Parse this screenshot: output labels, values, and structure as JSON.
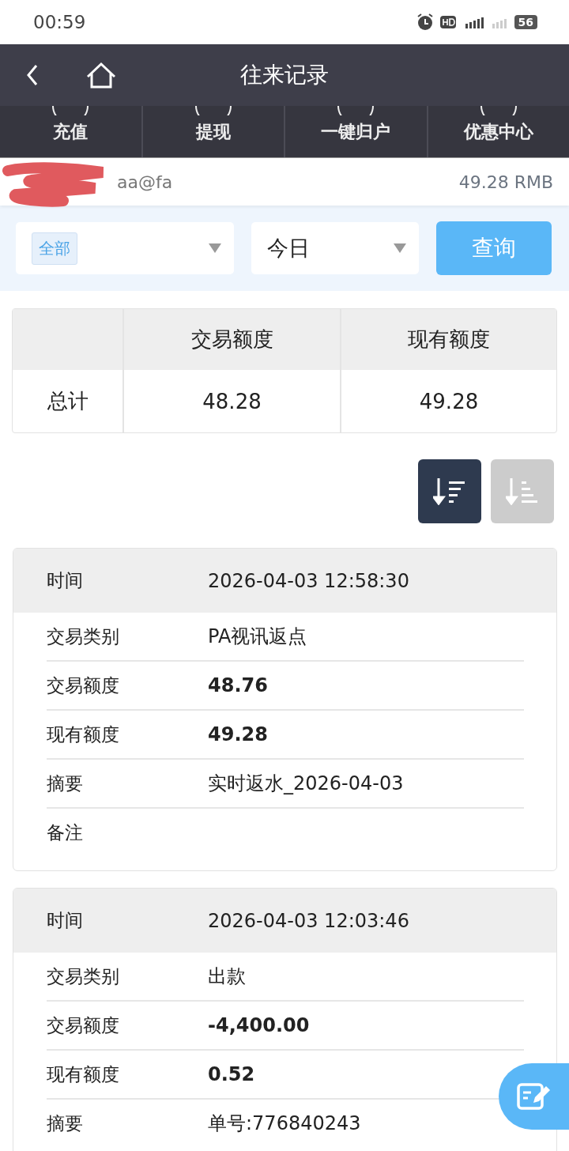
{
  "status_bar": {
    "time": "00:59",
    "battery": "56"
  },
  "header": {
    "title": "往来记录"
  },
  "menu": [
    {
      "label": "充值"
    },
    {
      "label": "提现"
    },
    {
      "label": "一键归户"
    },
    {
      "label": "优惠中心"
    }
  ],
  "account": {
    "user": "aa@fa",
    "balance": "49.28 RMB"
  },
  "filters": {
    "category": {
      "tag": "全部"
    },
    "period": {
      "value": "今日"
    },
    "query_button": "查询"
  },
  "summary": {
    "columns": [
      "交易额度",
      "现有额度"
    ],
    "rows": [
      {
        "label": "总计",
        "cells": [
          "48.28",
          "49.28"
        ]
      }
    ]
  },
  "sort_buttons": [
    {
      "kind": "desc",
      "selected": true
    },
    {
      "kind": "asc",
      "selected": false
    }
  ],
  "records": [
    {
      "header": {
        "label": "时间",
        "value": "2026-04-03 12:58:30"
      },
      "fields": [
        {
          "label": "交易类别",
          "value": "PA视讯返点",
          "bold": false
        },
        {
          "label": "交易额度",
          "value": "48.76",
          "bold": true
        },
        {
          "label": "现有额度",
          "value": "49.28",
          "bold": true
        },
        {
          "label": "摘要",
          "value": "实时返水_2026-04-03",
          "bold": false
        },
        {
          "label": "备注"
        }
      ]
    },
    {
      "header": {
        "label": "时间",
        "value": "2026-04-03 12:03:46"
      },
      "fields": [
        {
          "label": "交易类别",
          "value": "出款",
          "bold": false
        },
        {
          "label": "交易额度",
          "value": "-4,400.00",
          "bold": true
        },
        {
          "label": "现有额度",
          "value": "0.52",
          "bold": true
        },
        {
          "label": "摘要",
          "value": "单号:776840243",
          "bold": false
        }
      ]
    }
  ]
}
